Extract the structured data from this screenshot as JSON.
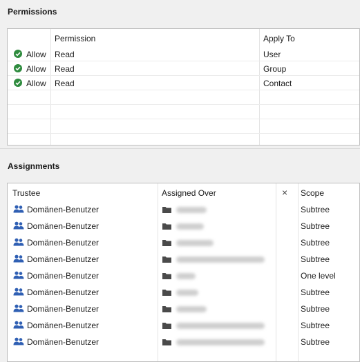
{
  "permissions": {
    "title": "Permissions",
    "columns": [
      "Permission",
      "Apply To"
    ],
    "rows": [
      {
        "access": "Allow",
        "permission": "Read",
        "apply_to": "User"
      },
      {
        "access": "Allow",
        "permission": "Read",
        "apply_to": "Group"
      },
      {
        "access": "Allow",
        "permission": "Read",
        "apply_to": "Contact"
      }
    ]
  },
  "assignments": {
    "title": "Assignments",
    "columns": [
      "Trustee",
      "Assigned Over",
      "×",
      "Scope"
    ],
    "rows": [
      {
        "trustee": "Domänen-Benutzer",
        "scope": "Subtree"
      },
      {
        "trustee": "Domänen-Benutzer",
        "scope": "Subtree"
      },
      {
        "trustee": "Domänen-Benutzer",
        "scope": "Subtree"
      },
      {
        "trustee": "Domänen-Benutzer",
        "scope": "Subtree"
      },
      {
        "trustee": "Domänen-Benutzer",
        "scope": "One level"
      },
      {
        "trustee": "Domänen-Benutzer",
        "scope": "Subtree"
      },
      {
        "trustee": "Domänen-Benutzer",
        "scope": "Subtree"
      },
      {
        "trustee": "Domänen-Benutzer",
        "scope": "Subtree"
      },
      {
        "trustee": "Domänen-Benutzer",
        "scope": "Subtree"
      }
    ]
  },
  "colors": {
    "allow_icon": "#2e8b3e",
    "trustee_icon": "#2f5fb3"
  },
  "icons": {
    "allow": "check-circle-icon",
    "trustee": "user-group-icon",
    "assigned_over": "folder-icon",
    "clear": "close-icon"
  }
}
